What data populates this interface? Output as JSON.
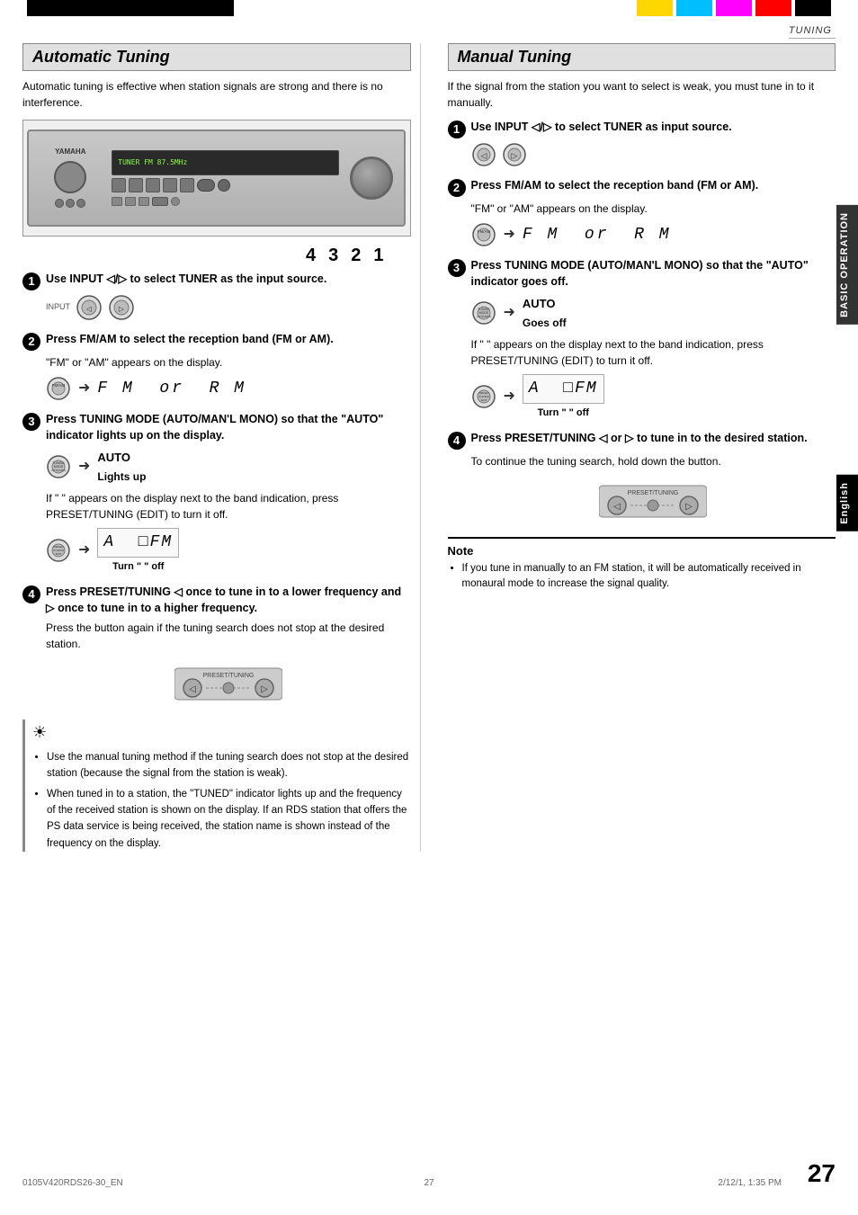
{
  "page": {
    "number": "27",
    "footer_left": "0105V420RDS26-30_EN",
    "footer_center": "27",
    "footer_right_time": "2/12/1, 1:35 PM"
  },
  "header": {
    "tuning_label": "TUNING"
  },
  "color_blocks": [
    "#000000",
    "#FFD700",
    "#00BFFF",
    "#FF00FF",
    "#FF0000",
    "#000000"
  ],
  "left_column": {
    "title": "Automatic Tuning",
    "description": "Automatic tuning is effective when station signals are strong and there is no interference.",
    "device_numbers": [
      "4",
      "3",
      "2",
      "1"
    ],
    "steps": [
      {
        "num": "1",
        "header": "Use INPUT ◁/▷ to select TUNER as the input source.",
        "body": ""
      },
      {
        "num": "2",
        "header": "Press FM/AM to select the reception band (FM or AM).",
        "body": "\"FM\" or \"AM\" appears on the display.",
        "display_text": "FM  or  AM",
        "display_symbol": "FM or RM"
      },
      {
        "num": "3",
        "header": "Press TUNING MODE (AUTO/MAN'L MONO) so that the \"AUTO\" indicator lights up on the display.",
        "body_indicator": "AUTO",
        "body_indicator_label": "Lights up",
        "body_note": "If \" \" appears on the display next to the band indication, press PRESET/TUNING (EDIT) to turn it off.",
        "turn_off_label": "Turn \" \" off"
      },
      {
        "num": "4",
        "header": "Press PRESET/TUNING ◁ once to tune in to a lower frequency and ▷ once to tune in to a higher frequency.",
        "body": "Press the button again if the tuning search does not stop at the desired station."
      }
    ],
    "tips": [
      "Use the manual tuning method if the tuning search does not stop at the desired station (because the signal from the station is weak).",
      "When tuned in to a station, the \"TUNED\" indicator lights up and the frequency of the received station is shown on the display. If an RDS station that offers the PS data service is being received, the station name is shown instead of the frequency on the display."
    ]
  },
  "right_column": {
    "title": "Manual Tuning",
    "description": "If the signal from the station you want to select is weak, you must tune in to it manually.",
    "steps": [
      {
        "num": "1",
        "header": "Use INPUT ◁/▷ to select TUNER as input source.",
        "body": ""
      },
      {
        "num": "2",
        "header": "Press FM/AM to select the reception band (FM or AM).",
        "body": "\"FM\" or \"AM\" appears on the display.",
        "display_symbol": "FM or RM"
      },
      {
        "num": "3",
        "header": "Press TUNING MODE (AUTO/MAN'L MONO) so that the \"AUTO\" indicator goes off.",
        "body_indicator": "AUTO",
        "body_indicator_label": "Goes off",
        "body_note": "If \" \" appears on the display next to the band indication, press PRESET/TUNING (EDIT) to turn it off.",
        "turn_off_label": "Turn \" \" off"
      },
      {
        "num": "4",
        "header": "Press PRESET/TUNING ◁ or ▷ to tune in to the desired station.",
        "body": "To continue the tuning search, hold down the button."
      }
    ],
    "note_title": "Note",
    "note_text": "If you tune in manually to an FM station, it will be automatically received in monaural mode to increase the signal quality."
  },
  "sidebar": {
    "basic_operation": "BASIC OPERATION",
    "english": "English"
  },
  "icons": {
    "input_left": "◁",
    "input_right": "▷",
    "fm_am_button": "FM/AM",
    "tuning_mode": "TUNING MODE",
    "preset_tuning": "PRESET/TUNING",
    "arrow": "➜"
  }
}
